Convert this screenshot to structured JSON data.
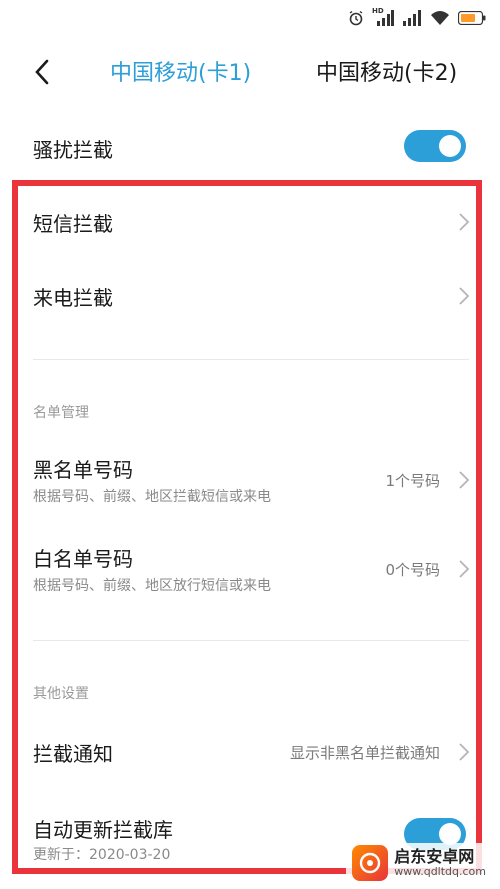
{
  "status_bar": {
    "icons": [
      "alarm-icon",
      "signal-hd-icon",
      "signal-icon",
      "wifi-icon",
      "battery-icon"
    ],
    "hd_label": "HD"
  },
  "header": {
    "back_icon": "chevron-left-icon",
    "tabs": [
      {
        "label": "中国移动(卡1)",
        "active": true
      },
      {
        "label": "中国移动(卡2)",
        "active": false
      }
    ]
  },
  "harassment": {
    "label": "骚扰拦截",
    "enabled": true
  },
  "intercept": {
    "sms_label": "短信拦截",
    "call_label": "来电拦截"
  },
  "list_management": {
    "section_label": "名单管理",
    "blacklist": {
      "title": "黑名单号码",
      "subtitle": "根据号码、前缀、地区拦截短信或来电",
      "value": "1个号码"
    },
    "whitelist": {
      "title": "白名单号码",
      "subtitle": "根据号码、前缀、地区放行短信或来电",
      "value": "0个号码"
    }
  },
  "other_settings": {
    "section_label": "其他设置",
    "notification": {
      "title": "拦截通知",
      "value": "显示非黑名单拦截通知"
    },
    "auto_update": {
      "title": "自动更新拦截库",
      "subtitle": "更新于：2020-03-20",
      "enabled": true
    }
  },
  "watermark": {
    "name": "启东安卓网",
    "url": "www.qdltdq.com"
  },
  "colors": {
    "accent": "#2c9ed8",
    "highlight": "#e8343a",
    "text_primary": "#1a1a1a",
    "text_secondary": "#8a8a8a"
  }
}
